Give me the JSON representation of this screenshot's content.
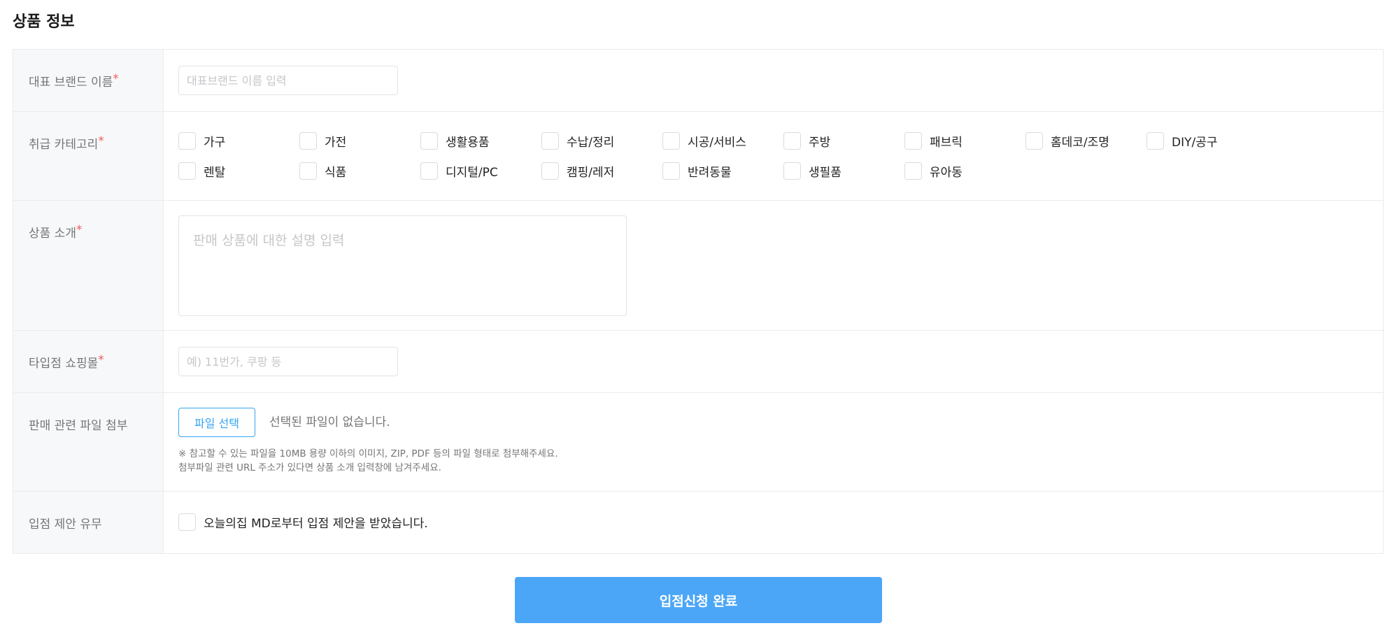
{
  "section": {
    "title": "상품 정보"
  },
  "brand": {
    "label": "대표 브랜드 이름",
    "required_mark": "*",
    "placeholder": "대표브랜드 이름 입력"
  },
  "category": {
    "label": "취급 카테고리",
    "required_mark": "*",
    "items": [
      {
        "label": "가구",
        "checked": false
      },
      {
        "label": "가전",
        "checked": false
      },
      {
        "label": "생활용품",
        "checked": false
      },
      {
        "label": "수납/정리",
        "checked": false
      },
      {
        "label": "시공/서비스",
        "checked": false
      },
      {
        "label": "주방",
        "checked": false
      },
      {
        "label": "패브릭",
        "checked": false
      },
      {
        "label": "홈데코/조명",
        "checked": false
      },
      {
        "label": "DIY/공구",
        "checked": false
      },
      {
        "label": "렌탈",
        "checked": false
      },
      {
        "label": "식품",
        "checked": false
      },
      {
        "label": "디지털/PC",
        "checked": false
      },
      {
        "label": "캠핑/레저",
        "checked": false
      },
      {
        "label": "반려동물",
        "checked": false
      },
      {
        "label": "생필품",
        "checked": false
      },
      {
        "label": "유아동",
        "checked": false
      }
    ]
  },
  "intro": {
    "label": "상품 소개",
    "required_mark": "*",
    "placeholder": "판매 상품에 대한 설명 입력"
  },
  "mall": {
    "label": "타입점 쇼핑몰",
    "required_mark": "*",
    "placeholder": "예) 11번가, 쿠팡 등"
  },
  "file": {
    "label": "판매 관련 파일 첨부",
    "button_label": "파일 선택",
    "status": "선택된 파일이 없습니다.",
    "note_line1": "※ 참고할 수 있는 파일을 10MB 용량 이하의 이미지, ZIP, PDF 등의 파일 형태로 첨부해주세요.",
    "note_line2": "첨부파일 관련 URL 주소가 있다면 상품 소개 입력창에 남겨주세요."
  },
  "offer": {
    "label": "입점 제안 유무",
    "checkbox_label": "오늘의집 MD로부터 입점 제안을 받았습니다.",
    "checked": false
  },
  "submit": {
    "label": "입점신청 완료"
  },
  "colors": {
    "accent": "#4ba6f7",
    "required": "#f25c5c",
    "label_bg": "#f7f8fa",
    "border": "#eaebed"
  }
}
